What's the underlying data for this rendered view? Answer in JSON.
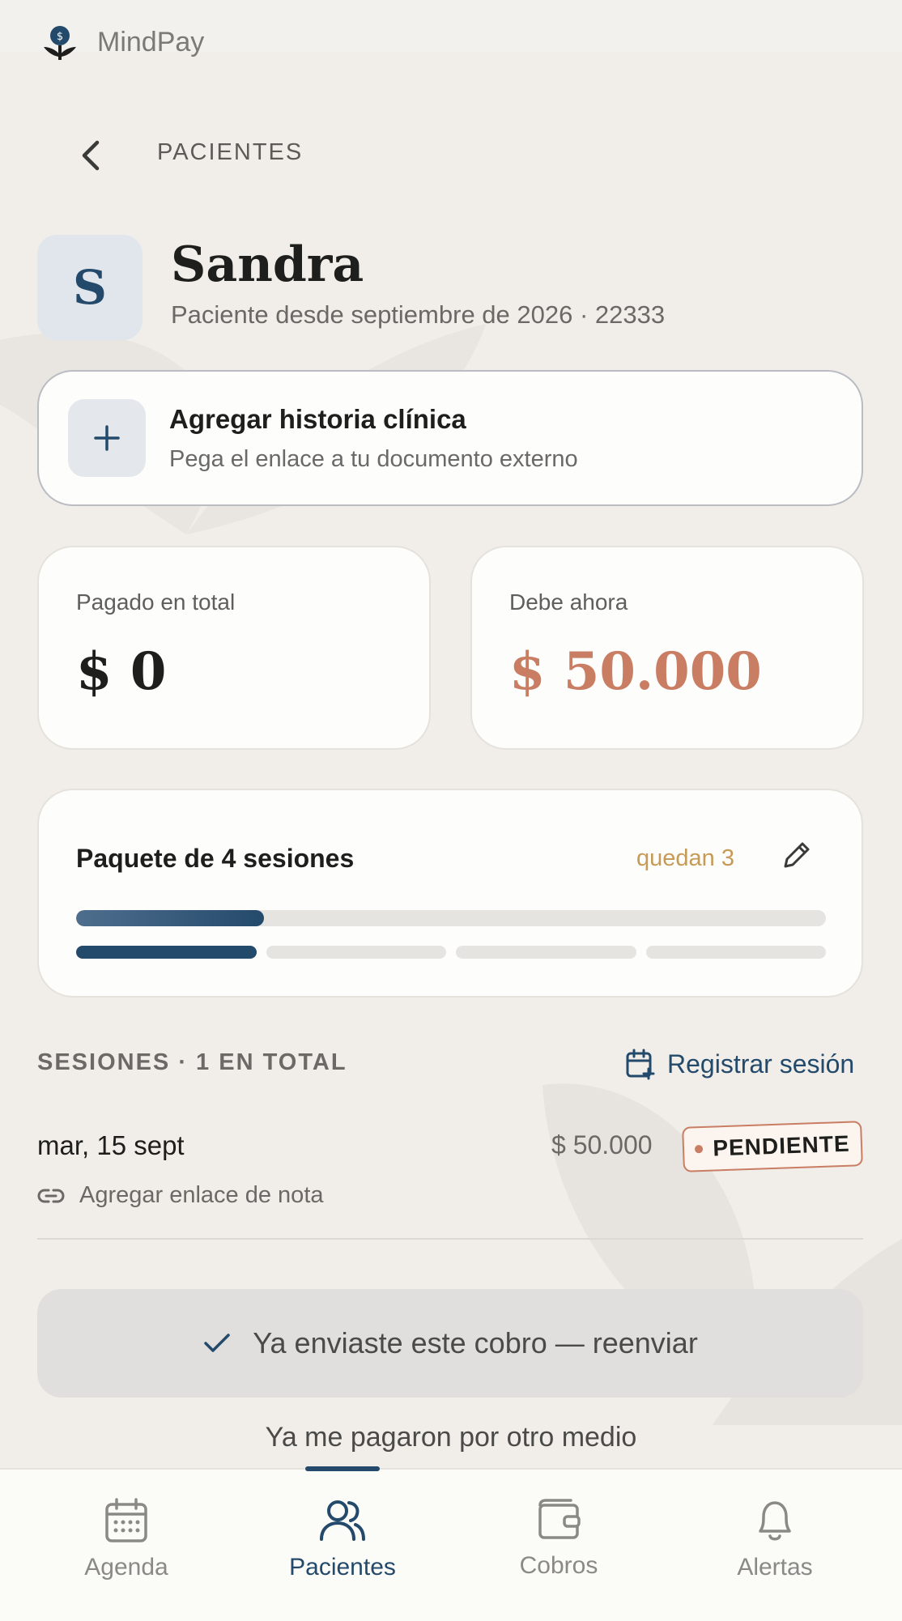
{
  "app": {
    "name": "MindPay"
  },
  "header": {
    "breadcrumb": "PACIENTES"
  },
  "patient": {
    "initial": "S",
    "name": "Sandra",
    "subtitle": "Paciente desde septiembre de 2026 · 22333"
  },
  "clinical_history": {
    "title": "Agregar historia clínica",
    "subtitle": "Pega el enlace a tu documento externo"
  },
  "stats": {
    "paid_label": "Pagado en total",
    "paid_value": "$ 0",
    "owed_label": "Debe ahora",
    "owed_value": "$ 50.000"
  },
  "package": {
    "title": "Paquete de 4 sesiones",
    "remaining": "quedan 3",
    "sessions_total": 4,
    "sessions_used": 1,
    "progress_fraction": 0.25
  },
  "sessions": {
    "header": "SESIONES · 1 EN TOTAL",
    "register_label": "Registrar sesión",
    "items": [
      {
        "date": "mar, 15 sept",
        "amount": "$ 50.000",
        "status": "PENDIENTE",
        "note_link": "Agregar enlace de nota"
      }
    ]
  },
  "actions": {
    "resend": "Ya enviaste este cobro — reenviar",
    "paid_other": "Ya me pagaron por otro medio"
  },
  "nav": {
    "items": [
      {
        "label": "Agenda",
        "icon": "calendar-icon"
      },
      {
        "label": "Pacientes",
        "icon": "users-icon",
        "active": true
      },
      {
        "label": "Cobros",
        "icon": "wallet-icon"
      },
      {
        "label": "Alertas",
        "icon": "bell-icon"
      }
    ]
  },
  "colors": {
    "accent": "#244a6b",
    "owed": "#c97d63",
    "remaining": "#c79a57",
    "background": "#f1eeea"
  }
}
